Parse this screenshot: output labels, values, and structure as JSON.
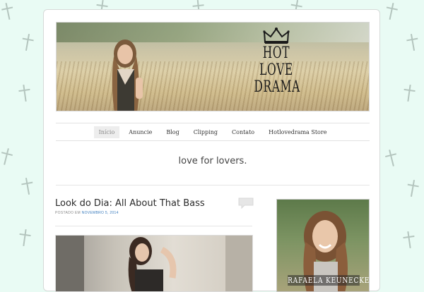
{
  "header": {
    "logo_lines": [
      "HOT",
      "LOVE",
      "DRAMA"
    ]
  },
  "nav": {
    "items": [
      {
        "label": "Início",
        "active": true
      },
      {
        "label": "Anuncie"
      },
      {
        "label": "Blog"
      },
      {
        "label": "Clipping"
      },
      {
        "label": "Contato"
      },
      {
        "label": "Hotlovedrama Store"
      }
    ]
  },
  "tagline": "love for lovers.",
  "post": {
    "title": "Look do Dia: All About That Bass",
    "meta_prefix": "POSTADO EM",
    "date": "NOVEMBRO 5, 2014"
  },
  "sidebar": {
    "caption": "RAFAELA KEUNECKE"
  },
  "icons": {
    "background": "cross-icon",
    "crown": "crown-icon",
    "comment": "comment-bubble-icon"
  },
  "colors": {
    "background": "#e9fbf4",
    "link": "#3a7bbd",
    "text": "#2b2b2b"
  }
}
